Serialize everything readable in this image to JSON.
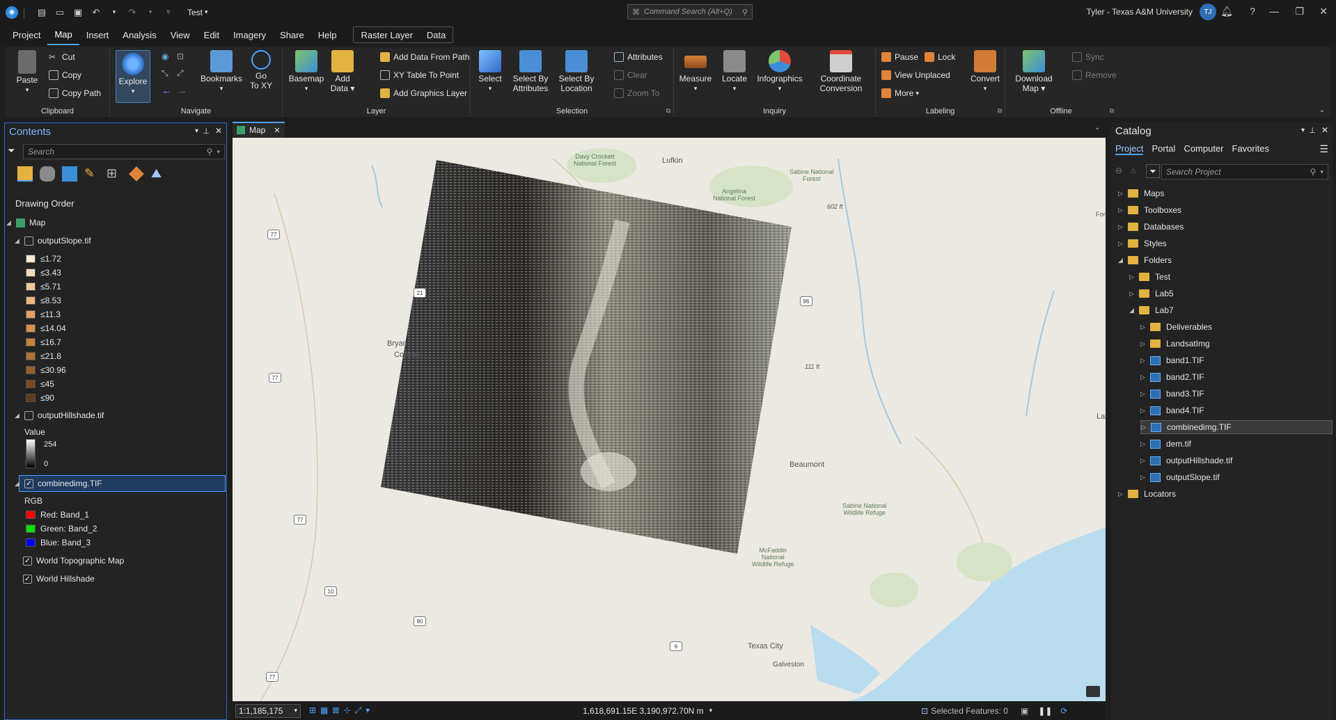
{
  "titlebar": {
    "project_name": "Test",
    "command_search_placeholder": "Command Search (Alt+Q)",
    "user": "Tyler - Texas A&M University",
    "avatar_initials": "TJ"
  },
  "menu": {
    "tabs": [
      "Project",
      "Map",
      "Insert",
      "Analysis",
      "View",
      "Edit",
      "Imagery",
      "Share",
      "Help"
    ],
    "active": "Map",
    "context_tabs": [
      "Raster Layer",
      "Data"
    ]
  },
  "ribbon": {
    "clipboard": {
      "label": "Clipboard",
      "paste": "Paste",
      "cut": "Cut",
      "copy": "Copy",
      "copy_path": "Copy Path"
    },
    "navigate": {
      "label": "Navigate",
      "explore": "Explore",
      "bookmarks": "Bookmarks",
      "goto_line1": "Go",
      "goto_line2": "To XY"
    },
    "layer": {
      "label": "Layer",
      "basemap": "Basemap",
      "add_line1": "Add",
      "add_line2": "Data",
      "add_data_from_path": "Add Data From Path",
      "xy_table_to_point": "XY Table To Point",
      "add_graphics_layer": "Add Graphics Layer"
    },
    "selection": {
      "label": "Selection",
      "select": "Select",
      "sba_line1": "Select By",
      "sba_line2": "Attributes",
      "sbl_line1": "Select By",
      "sbl_line2": "Location",
      "attributes": "Attributes",
      "clear": "Clear",
      "zoom_to": "Zoom To"
    },
    "inquiry": {
      "label": "Inquiry",
      "measure": "Measure",
      "locate": "Locate",
      "infographics": "Infographics",
      "cc_line1": "Coordinate",
      "cc_line2": "Conversion"
    },
    "labeling": {
      "label": "Labeling",
      "pause": "Pause",
      "lock": "Lock",
      "view_unplaced": "View Unplaced",
      "more": "More",
      "convert": "Convert"
    },
    "offline": {
      "label": "Offline",
      "dl_line1": "Download",
      "dl_line2": "Map",
      "sync": "Sync",
      "remove": "Remove"
    }
  },
  "contents": {
    "title": "Contents",
    "search_placeholder": "Search",
    "drawing_order": "Drawing Order",
    "map": "Map",
    "slope_layer": "outputSlope.tif",
    "slope_classes": [
      {
        "label": "≤1.72",
        "color": "#fbe9d6"
      },
      {
        "label": "≤3.43",
        "color": "#f6dcbd"
      },
      {
        "label": "≤5.71",
        "color": "#efc99b"
      },
      {
        "label": "≤8.53",
        "color": "#e8b87d"
      },
      {
        "label": "≤11.3",
        "color": "#dfa462"
      },
      {
        "label": "≤14.04",
        "color": "#d4934c"
      },
      {
        "label": "≤16.7",
        "color": "#c3823f"
      },
      {
        "label": "≤21.8",
        "color": "#ad7236"
      },
      {
        "label": "≤30.96",
        "color": "#93602c"
      },
      {
        "label": "≤45",
        "color": "#774d23"
      },
      {
        "label": "≤90",
        "color": "#5e3b1a"
      }
    ],
    "hillshade_layer": "outputHillshade.tif",
    "value_label": "Value",
    "value_max": "254",
    "value_min": "0",
    "combined_layer": "combinedimg.TIF",
    "rgb_label": "RGB",
    "bands": [
      {
        "label": "Red:  Band_1",
        "color": "#ff0000"
      },
      {
        "label": "Green: Band_2",
        "color": "#00e000"
      },
      {
        "label": "Blue:  Band_3",
        "color": "#0000ff"
      }
    ],
    "topo": "World Topographic Map",
    "hillshade_basemap": "World Hillshade"
  },
  "map_tab": "Map",
  "map_labels": {
    "lufkin": "Lufkin",
    "davy_line1": "Davy Crockett",
    "davy_line2": "National Forest",
    "angelina_line1": "Angelina",
    "angelina_line2": "National Forest",
    "sabine_line1": "Sabine National",
    "sabine_line2": "Forest",
    "elev602": "602 ft",
    "bryan": "Bryan",
    "college": "College",
    "elev111": "111 ft",
    "beaumont": "Beaumont",
    "sabine_refuge_line1": "Sabine National",
    "sabine_refuge_line2": "Wildlife Refuge",
    "mcfaddin_line1": "McFaddin",
    "mcfaddin_line2": "National",
    "mcfaddin_line3": "Wildlife Refuge",
    "texas_city": "Texas City",
    "galveston": "Galveston",
    "la": "La",
    "for": "For",
    "shields": [
      "77",
      "21",
      "77",
      "77",
      "96",
      "10",
      "90",
      "6",
      "77"
    ]
  },
  "status": {
    "scale": "1:1,185,175",
    "coords": "1,618,691.15E 3,190,972.70N m",
    "selected": "Selected Features: 0"
  },
  "catalog": {
    "title": "Catalog",
    "tabs": [
      "Project",
      "Portal",
      "Computer",
      "Favorites"
    ],
    "active_tab": "Project",
    "search_placeholder": "Search Project",
    "items": [
      "Maps",
      "Toolboxes",
      "Databases",
      "Styles",
      "Folders",
      "Test",
      "Lab5",
      "Lab7",
      "Deliverables",
      "LandsatImg",
      "band1.TIF",
      "band2.TIF",
      "band3.TIF",
      "band4.TIF",
      "combinedimg.TIF",
      "dem.tif",
      "outputHillshade.tif",
      "outputSlope.tif",
      "Locators"
    ]
  }
}
